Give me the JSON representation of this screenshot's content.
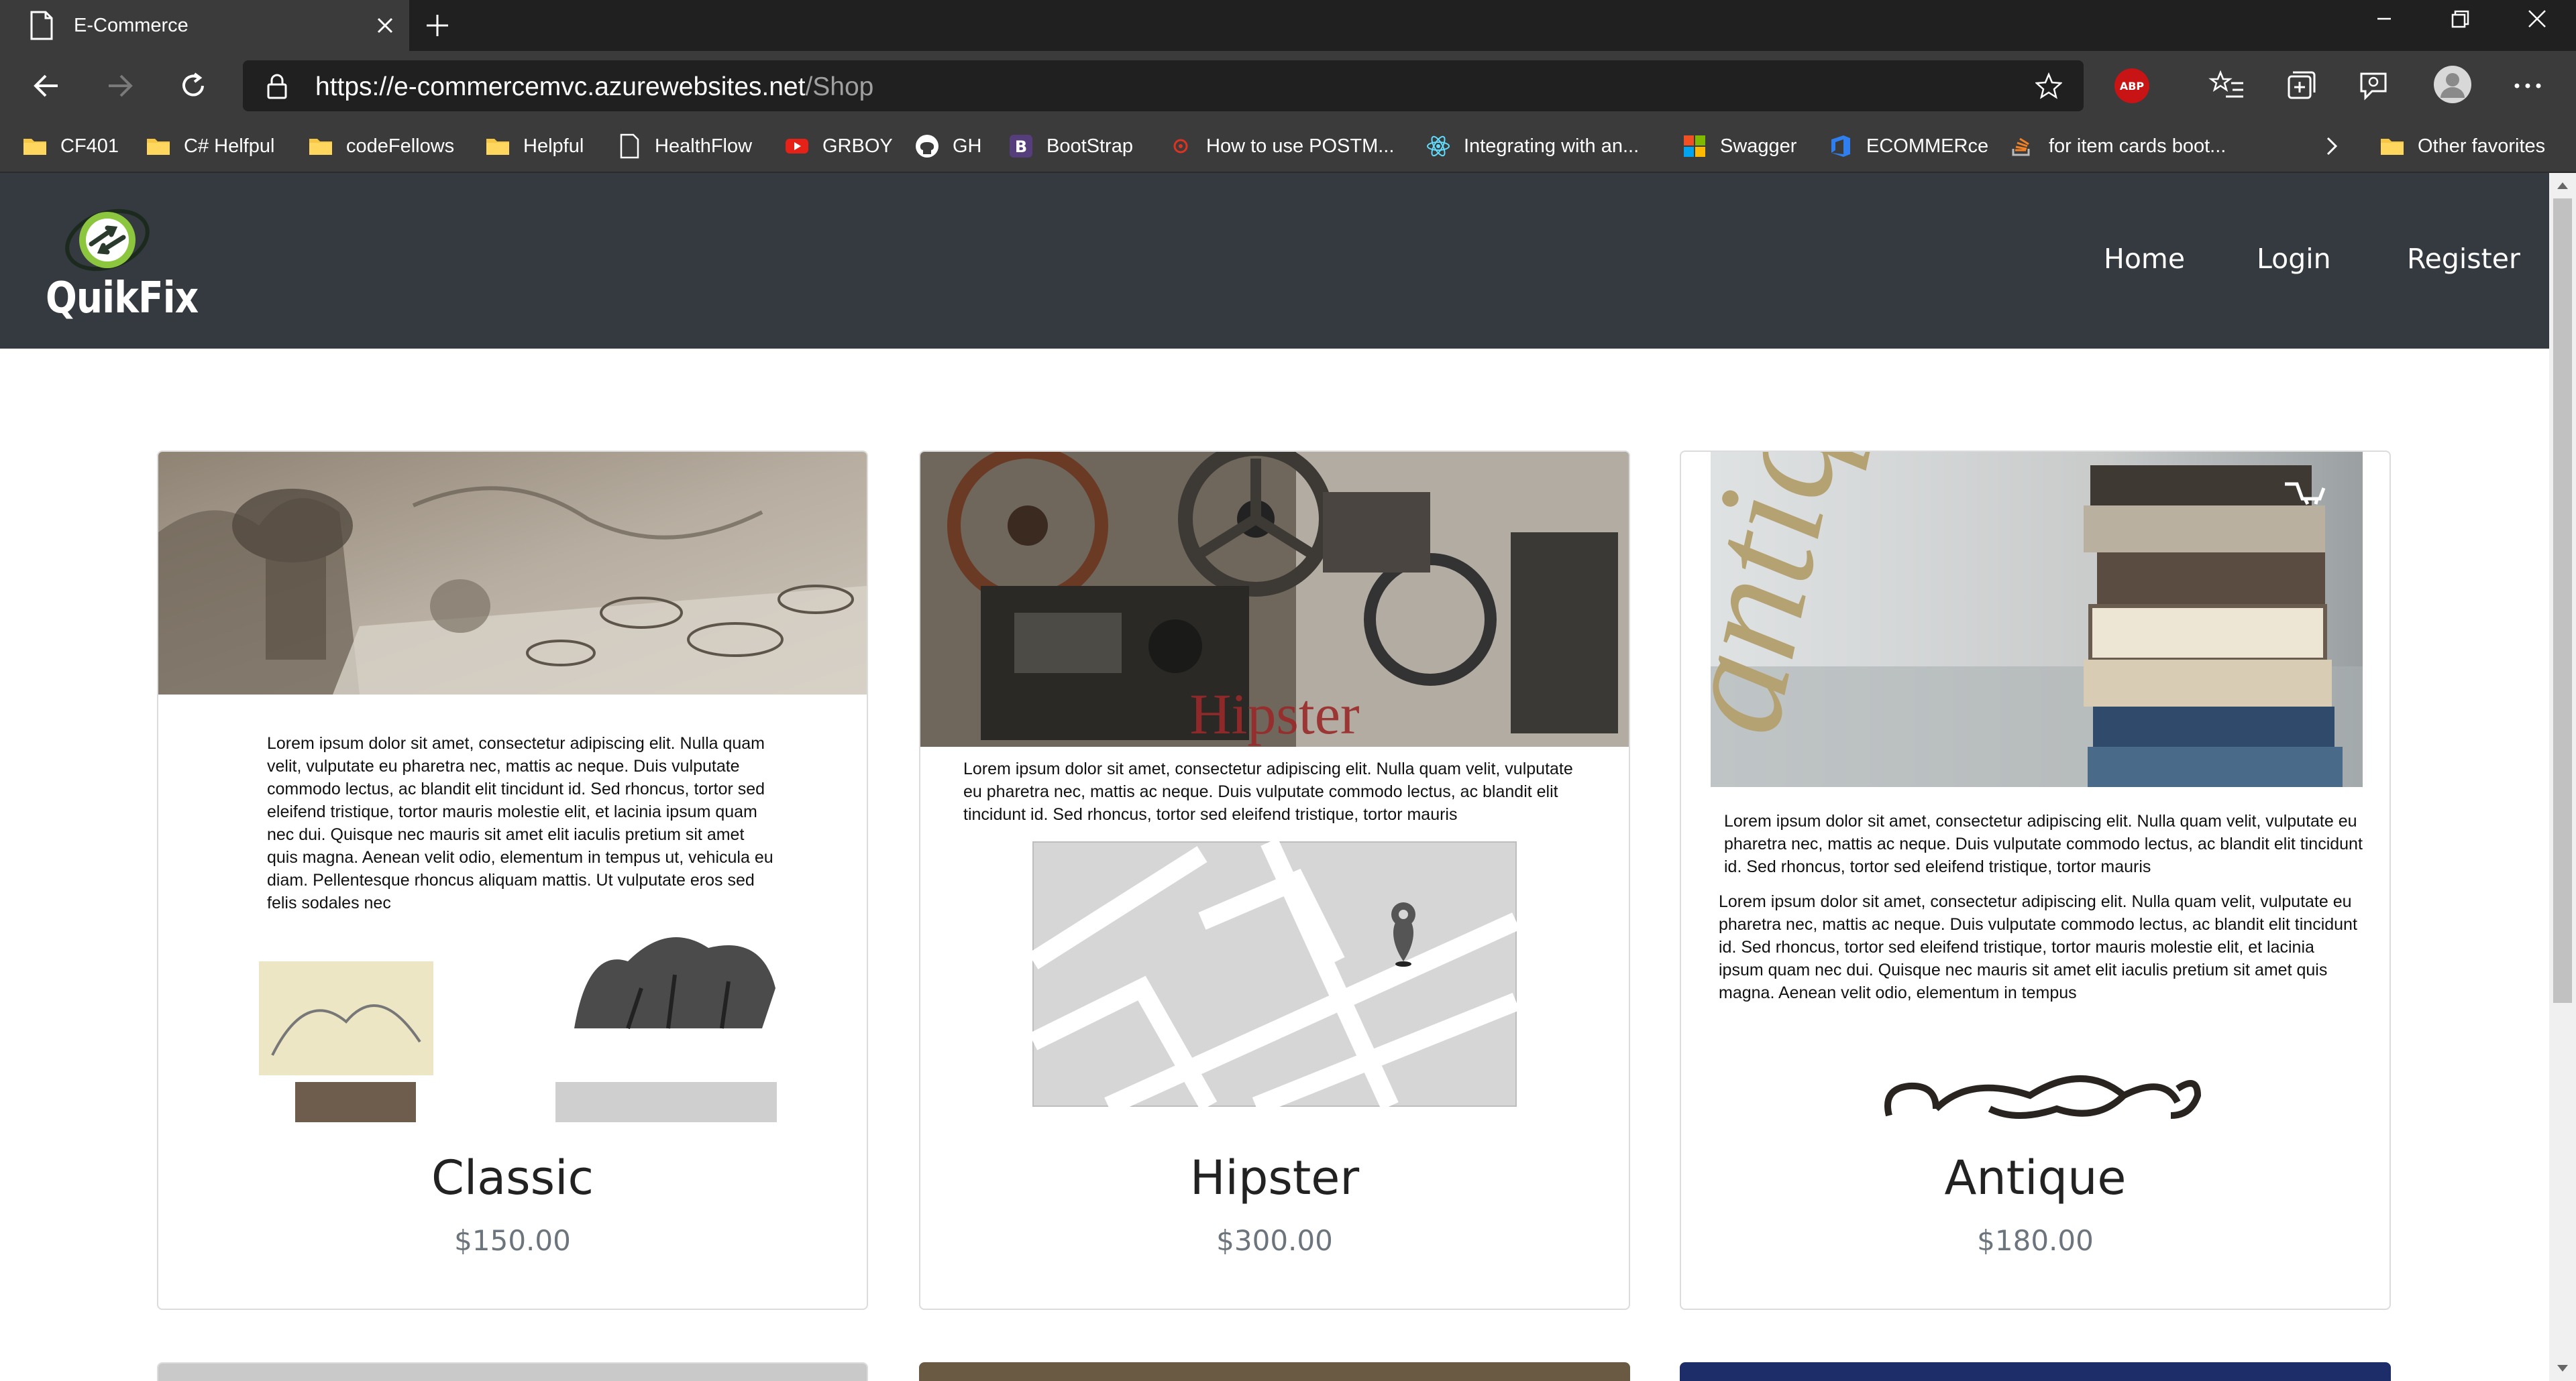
{
  "browser": {
    "tab_title": "E-Commerce",
    "url_host": "https://e-commercemvc.azurewebsites.net",
    "url_path": "/Shop",
    "abp_label": "ABP",
    "bookmarks": [
      {
        "label": "CF401",
        "icon": "folder-icon"
      },
      {
        "label": "C# Helfpul",
        "icon": "folder-icon"
      },
      {
        "label": "codeFellows",
        "icon": "folder-icon"
      },
      {
        "label": "Helpful",
        "icon": "folder-icon"
      },
      {
        "label": "HealthFlow",
        "icon": "page-icon"
      },
      {
        "label": "GRBOY",
        "icon": "youtube-icon"
      },
      {
        "label": "GH",
        "icon": "github-icon"
      },
      {
        "label": "BootStrap",
        "icon": "bootstrap-icon"
      },
      {
        "label": "How to use POSTM...",
        "icon": "postman-icon"
      },
      {
        "label": "Integrating with an...",
        "icon": "react-icon"
      },
      {
        "label": "Swagger",
        "icon": "microsoft-icon"
      },
      {
        "label": "ECOMMERce",
        "icon": "devops-icon"
      },
      {
        "label": "for item cards boot...",
        "icon": "stackoverflow-icon"
      }
    ],
    "other_favorites": "Other favorites"
  },
  "site": {
    "brand": "QuikFix",
    "nav": [
      "Home",
      "Login",
      "Register"
    ]
  },
  "products": [
    {
      "name": "Classic",
      "price": "$150.00",
      "lorem": "Lorem ipsum dolor sit amet, consectetur adipiscing elit. Nulla quam velit, vulputate eu pharetra nec, mattis ac neque. Duis vulputate commodo lectus, ac blandit elit tincidunt id. Sed rhoncus, tortor sed eleifend tristique, tortor mauris molestie elit, et lacinia ipsum quam nec dui. Quisque nec mauris sit amet elit iaculis pretium sit amet quis magna. Aenean velit odio, elementum in tempus ut, vehicula eu diam. Pellentesque rhoncus aliquam mattis. Ut vulputate eros sed felis sodales nec"
    },
    {
      "name": "Hipster",
      "price": "$300.00",
      "banner": "Hipster",
      "lorem": "Lorem ipsum dolor sit amet, consectetur adipiscing elit. Nulla quam velit, vulputate eu pharetra nec, mattis ac neque. Duis vulputate commodo lectus, ac blandit elit tincidunt id. Sed rhoncus, tortor sed eleifend tristique, tortor mauris"
    },
    {
      "name": "Antique",
      "price": "$180.00",
      "banner": "antique",
      "lorem1": "Lorem ipsum dolor sit amet, consectetur adipiscing elit. Nulla quam velit, vulputate eu pharetra nec, mattis ac neque. Duis vulputate commodo lectus, ac blandit elit tincidunt id. Sed rhoncus, tortor sed eleifend tristique, tortor mauris",
      "lorem2": "Lorem ipsum dolor sit amet, consectetur adipiscing elit. Nulla quam velit, vulputate eu pharetra nec, mattis ac neque. Duis vulputate commodo lectus, ac blandit elit tincidunt id. Sed rhoncus, tortor sed eleifend tristique, tortor mauris molestie elit, et lacinia ipsum quam nec dui. Quisque nec mauris sit amet elit iaculis pretium sit amet quis magna. Aenean velit odio, elementum in tempus"
    }
  ],
  "colors": {
    "navbar": "#343a40",
    "price": "#6c757d",
    "chrome_dark": "#202020",
    "chrome": "#3b3b3b"
  }
}
